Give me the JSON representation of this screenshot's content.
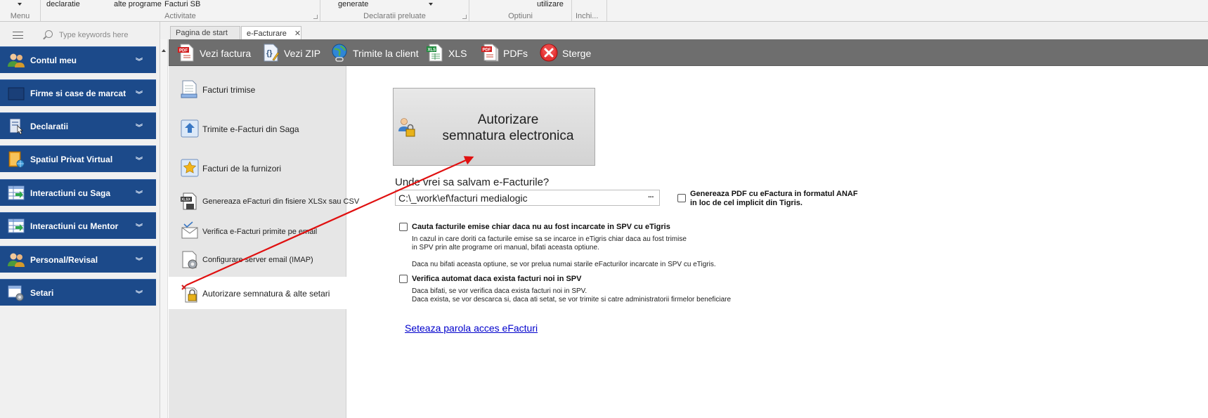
{
  "ribbon": {
    "menu_caption": "Menu",
    "activity_items": [
      "declaratie",
      "alte programe",
      "Facturi SB"
    ],
    "activity_caption": "Activitate",
    "declarations_item": "generate",
    "declarations_caption": "Declaratii preluate",
    "options_item": "utilizare",
    "options_caption": "Optiuni",
    "close_caption": "Inchi..."
  },
  "search": {
    "placeholder": "Type keywords here"
  },
  "nav": {
    "items": [
      {
        "label": "Contul meu",
        "icon": "users-icon"
      },
      {
        "label": "Firme si case de marcat",
        "icon": "building-icon"
      },
      {
        "label": "Declaratii",
        "icon": "document-cursor-icon"
      },
      {
        "label": "Spatiul Privat Virtual",
        "icon": "book-globe-icon"
      },
      {
        "label": "Interactiuni cu Saga",
        "icon": "table-arrow-icon"
      },
      {
        "label": "Interactiuni cu Mentor",
        "icon": "table-arrow-icon"
      },
      {
        "label": "Personal/Revisal",
        "icon": "users-icon"
      },
      {
        "label": "Setari",
        "icon": "settings-gear-icon"
      }
    ]
  },
  "tabs": [
    {
      "label": "Pagina de start"
    },
    {
      "label": "e-Facturare",
      "close": "✕"
    }
  ],
  "toolbar": {
    "view_invoice": "Vezi factura",
    "view_zip": "Vezi ZIP",
    "send_to_client": "Trimite la client",
    "xls": "XLS",
    "pdfs": "PDFs",
    "delete": "Sterge"
  },
  "submenu": {
    "items": [
      {
        "label": "Facturi trimise"
      },
      {
        "label": "Trimite e-Facturi din Saga"
      },
      {
        "label": "Facturi de la furnizori"
      },
      {
        "label": "Genereaza eFacturi din fisiere XLSx sau CSV"
      },
      {
        "label": "Verifica e-Facturi primite pe email"
      },
      {
        "label": "Configurare server email (IMAP)"
      },
      {
        "label": "Autorizare semnatura & alte setari"
      }
    ]
  },
  "main": {
    "auth_button_line1": "Autorizare",
    "auth_button_line2": "semnatura electronica",
    "save_question": "Unde vrei sa salvam e-Facturile?",
    "save_path": "C:\\_work\\ef\\facturi medialogic",
    "browse_dots": "···",
    "pdf_option_line1": "Genereaza PDF cu eFactura in formatul ANAF",
    "pdf_option_line2": "in loc de cel implicit din Tigris.",
    "search_option": "Cauta facturile emise chiar daca nu au fost incarcate in SPV cu eTigris",
    "search_desc_1": "In cazul in care doriti ca facturile emise sa se incarce in eTigris chiar daca au fost trimise",
    "search_desc_2": "in SPV prin alte programe ori manual, bifati aceasta optiune.",
    "search_desc_3": "Daca nu bifati aceasta optiune, se vor prelua numai starile eFacturilor incarcate in SPV cu eTigris.",
    "auto_option": "Verifica automat daca exista facturi noi in SPV",
    "auto_desc_1": "Daca bifati, se vor verifica daca exista facturi noi in SPV.",
    "auto_desc_2": "Daca exista, se vor descarca si, daca ati setat, se vor trimite si catre administratorii firmelor beneficiare",
    "password_link": "Seteaza parola acces eFacturi"
  },
  "colors": {
    "nav_bg": "#1c4a8a",
    "toolbar_bg": "#6e6e6e",
    "annotation_arrow": "#e01010",
    "link": "#0000cc"
  }
}
